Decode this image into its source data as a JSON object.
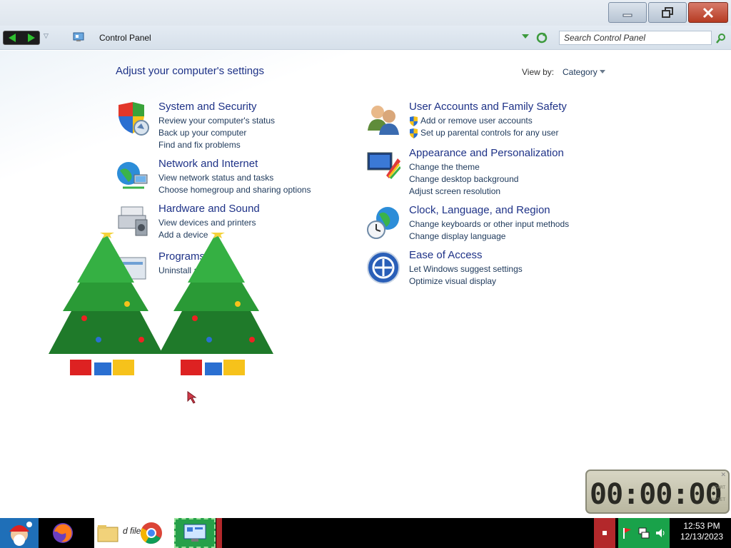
{
  "window": {
    "minimize_icon": "minimize-icon",
    "restore_icon": "restore-icon",
    "close_icon": "close-icon"
  },
  "address": {
    "breadcrumb": "Control Panel",
    "search_placeholder": "Search Control Panel"
  },
  "main": {
    "heading": "Adjust your computer's settings",
    "view_by_label": "View by:",
    "view_by_value": "Category"
  },
  "categories": [
    {
      "title": "System and Security",
      "icon": "shield-icon",
      "links": [
        "Review your computer's status",
        "Back up your computer",
        "Find and fix problems"
      ]
    },
    {
      "title": "Network and Internet",
      "icon": "globe-network-icon",
      "links": [
        "View network status and tasks",
        "Choose homegroup and sharing options"
      ]
    },
    {
      "title": "Hardware and Sound",
      "icon": "printer-speaker-icon",
      "links": [
        "View devices and printers",
        "Add a device"
      ]
    },
    {
      "title": "Programs",
      "icon": "programs-icon",
      "links": [
        "Uninstall a program"
      ]
    },
    {
      "title": "User Accounts and Family Safety",
      "icon": "users-icon",
      "links": [
        "Add or remove user accounts",
        "Set up parental controls for any user"
      ]
    },
    {
      "title": "Appearance and Personalization",
      "icon": "monitor-paint-icon",
      "links": [
        "Change the theme",
        "Change desktop background",
        "Adjust screen resolution"
      ]
    },
    {
      "title": "Clock, Language, and Region",
      "icon": "clock-globe-icon",
      "links": [
        "Change keyboards or other input methods",
        "Change display language"
      ]
    },
    {
      "title": "Ease of Access",
      "icon": "ease-of-access-icon",
      "links": [
        "Let Windows suggest settings",
        "Optimize visual display"
      ]
    }
  ],
  "stopwatch": {
    "time": "00:00:00",
    "start_label": "START",
    "reset_label": "RESET"
  },
  "taskbar": {
    "files_label": "d files",
    "time": "12:53 PM",
    "date": "12/13/2023"
  },
  "colors": {
    "link": "#1e395b",
    "title": "#1e3287",
    "taskbar": "#000000"
  }
}
